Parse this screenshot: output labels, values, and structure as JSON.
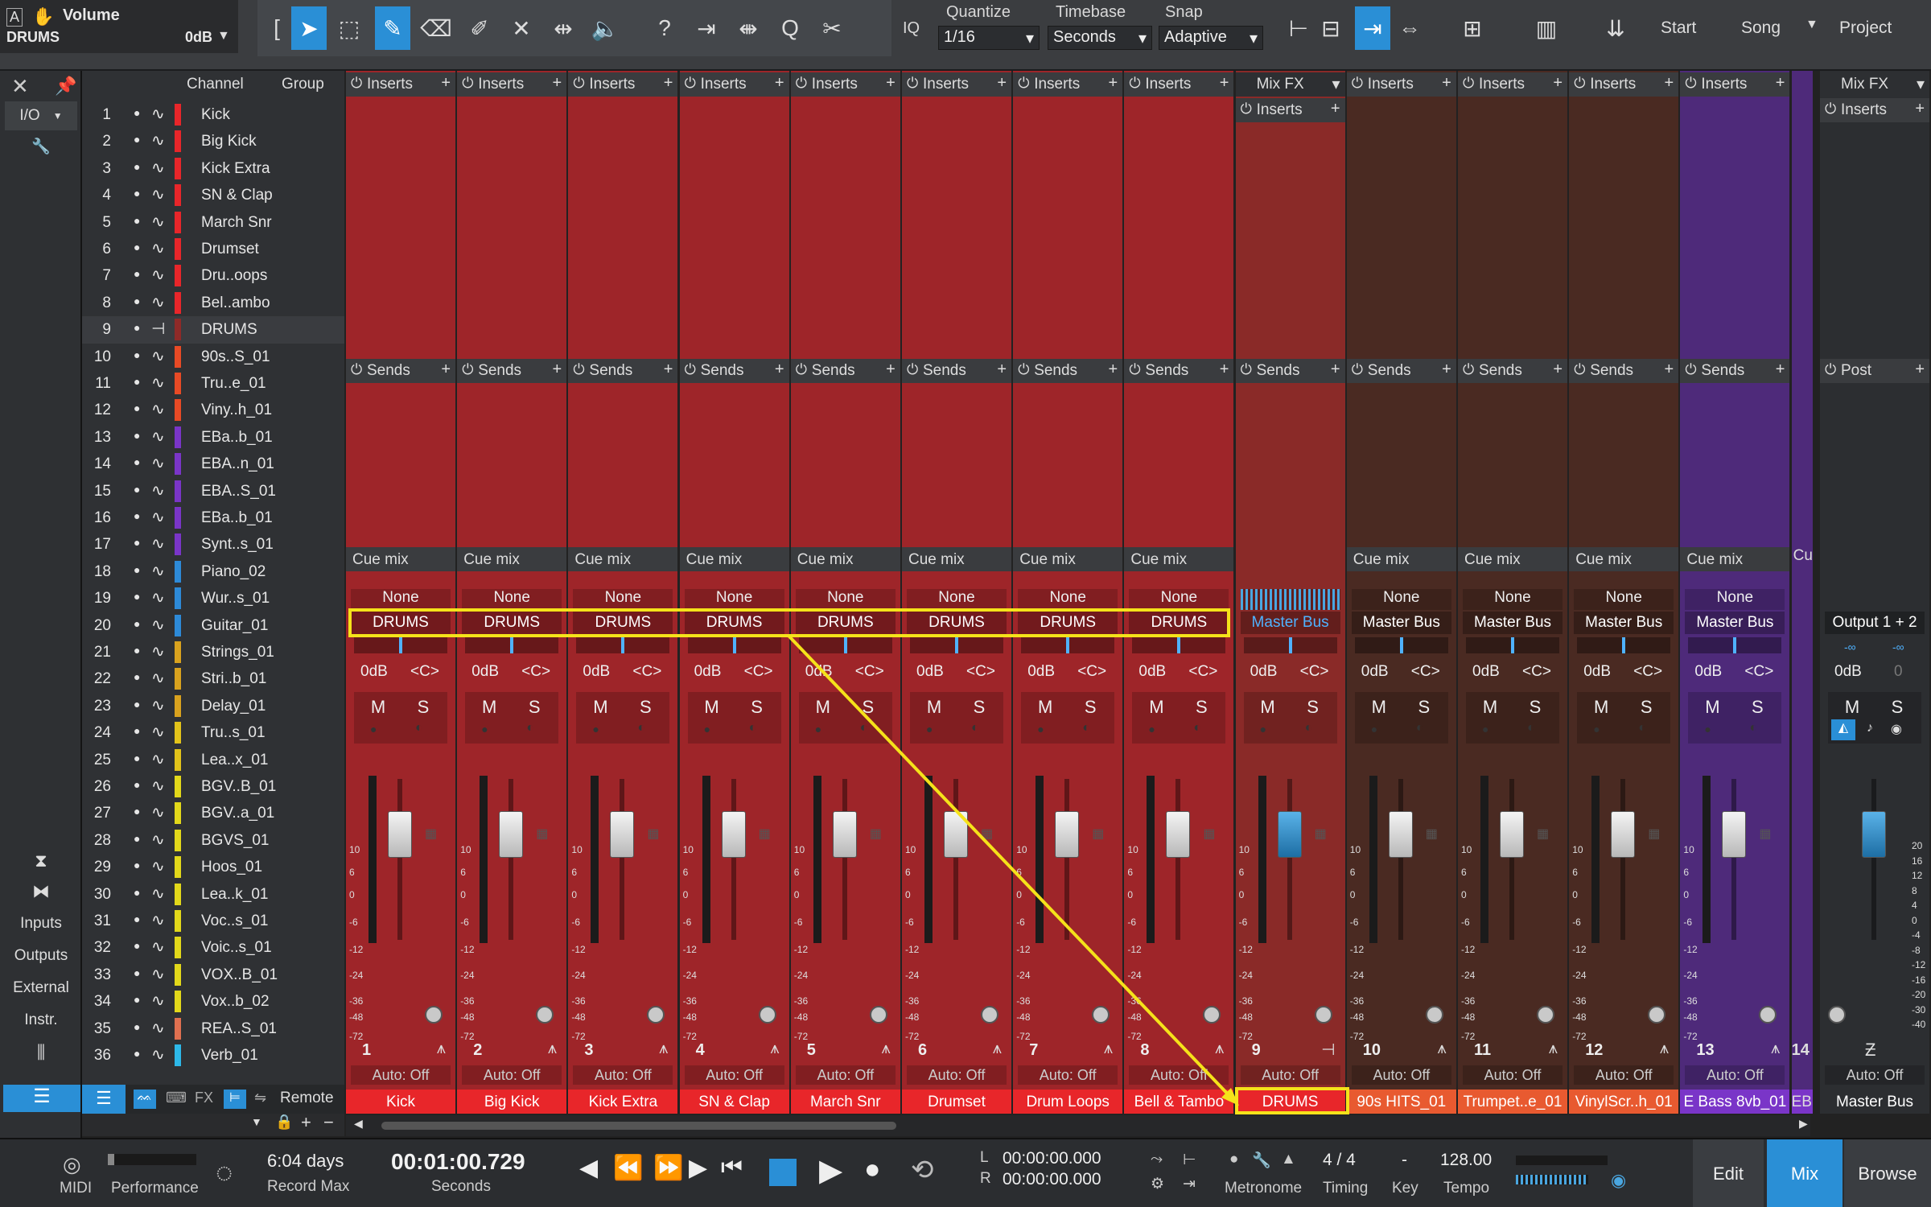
{
  "header": {
    "track_title": "Volume",
    "track_name": "DRUMS",
    "volume": "0dB"
  },
  "toolbar": {
    "iq": "IQ",
    "quantize_label": "Quantize",
    "quantize_value": "1/16",
    "timebase_label": "Timebase",
    "timebase_value": "Seconds",
    "snap_label": "Snap",
    "snap_value": "Adaptive",
    "start": "Start",
    "song": "Song",
    "project": "Project"
  },
  "sidebar": {
    "io": "I/O",
    "inputs": "Inputs",
    "outputs": "Outputs",
    "external": "External",
    "instr": "Instr."
  },
  "channel_list": {
    "col_channel": "Channel",
    "col_group": "Group",
    "rows": [
      {
        "n": "1",
        "name": "Kick",
        "color": "#e8262a"
      },
      {
        "n": "2",
        "name": "Big Kick",
        "color": "#e8262a"
      },
      {
        "n": "3",
        "name": "Kick Extra",
        "color": "#e8262a"
      },
      {
        "n": "4",
        "name": "SN & Clap",
        "color": "#e8262a"
      },
      {
        "n": "5",
        "name": "March Snr",
        "color": "#e8262a"
      },
      {
        "n": "6",
        "name": "Drumset",
        "color": "#e8262a"
      },
      {
        "n": "7",
        "name": "Dru..oops",
        "color": "#e8262a"
      },
      {
        "n": "8",
        "name": "Bel..ambo",
        "color": "#e8262a"
      },
      {
        "n": "9",
        "name": "DRUMS",
        "color": "#8f2a28"
      },
      {
        "n": "10",
        "name": "90s..S_01",
        "color": "#e84a25"
      },
      {
        "n": "11",
        "name": "Tru..e_01",
        "color": "#e84a25"
      },
      {
        "n": "12",
        "name": "Viny..h_01",
        "color": "#e84a25"
      },
      {
        "n": "13",
        "name": "EBa..b_01",
        "color": "#7a35c8"
      },
      {
        "n": "14",
        "name": "EBA..n_01",
        "color": "#7a35c8"
      },
      {
        "n": "15",
        "name": "EBA..S_01",
        "color": "#7a35c8"
      },
      {
        "n": "16",
        "name": "EBa..b_01",
        "color": "#7a35c8"
      },
      {
        "n": "17",
        "name": "Synt..s_01",
        "color": "#7a35c8"
      },
      {
        "n": "18",
        "name": "Piano_02",
        "color": "#2d8ad8"
      },
      {
        "n": "19",
        "name": "Wur..s_01",
        "color": "#2d8ad8"
      },
      {
        "n": "20",
        "name": "Guitar_01",
        "color": "#2d8ad8"
      },
      {
        "n": "21",
        "name": "Strings_01",
        "color": "#d9a21e"
      },
      {
        "n": "22",
        "name": "Stri..b_01",
        "color": "#d9a21e"
      },
      {
        "n": "23",
        "name": "Delay_01",
        "color": "#d9a21e"
      },
      {
        "n": "24",
        "name": "Tru..s_01",
        "color": "#e2c31a"
      },
      {
        "n": "25",
        "name": "Lea..x_01",
        "color": "#e2c31a"
      },
      {
        "n": "26",
        "name": "BGV..B_01",
        "color": "#e2d81a"
      },
      {
        "n": "27",
        "name": "BGV..a_01",
        "color": "#e2d81a"
      },
      {
        "n": "28",
        "name": "BGVS_01",
        "color": "#e2d81a"
      },
      {
        "n": "29",
        "name": "Hoos_01",
        "color": "#e2d81a"
      },
      {
        "n": "30",
        "name": "Lea..k_01",
        "color": "#e2d81a"
      },
      {
        "n": "31",
        "name": "Voc..s_01",
        "color": "#e2d81a"
      },
      {
        "n": "32",
        "name": "Voic..s_01",
        "color": "#e2d81a"
      },
      {
        "n": "33",
        "name": "VOX..B_01",
        "color": "#e2d81a"
      },
      {
        "n": "34",
        "name": "Vox..b_02",
        "color": "#e2d81a"
      },
      {
        "n": "35",
        "name": "REA..S_01",
        "color": "#e07050"
      },
      {
        "n": "36",
        "name": "Verb_01",
        "color": "#2db8e8"
      }
    ],
    "remote": "Remote"
  },
  "mixer": {
    "inserts_label": "Inserts",
    "sends_label": "Sends",
    "cue_label": "Cue mix",
    "mixfx_label": "Mix FX",
    "post_label": "Post",
    "none_label": "None",
    "auto_label": "Auto: Off",
    "m_label": "M",
    "s_label": "S",
    "vol_label": "0dB",
    "pan_label": "<C>",
    "strips": [
      {
        "num": "1",
        "name": "Kick",
        "output": "DRUMS",
        "bg": "#9e2529",
        "namebg": "#e8262a"
      },
      {
        "num": "2",
        "name": "Big Kick",
        "output": "DRUMS",
        "bg": "#9e2529",
        "namebg": "#e8262a"
      },
      {
        "num": "3",
        "name": "Kick Extra",
        "output": "DRUMS",
        "bg": "#9e2529",
        "namebg": "#e8262a"
      },
      {
        "num": "4",
        "name": "SN & Clap",
        "output": "DRUMS",
        "bg": "#9e2529",
        "namebg": "#e8262a"
      },
      {
        "num": "5",
        "name": "March Snr",
        "output": "DRUMS",
        "bg": "#9e2529",
        "namebg": "#e8262a"
      },
      {
        "num": "6",
        "name": "Drumset",
        "output": "DRUMS",
        "bg": "#9e2529",
        "namebg": "#e8262a"
      },
      {
        "num": "7",
        "name": "Drum Loops",
        "output": "DRUMS",
        "bg": "#9e2529",
        "namebg": "#e8262a"
      },
      {
        "num": "8",
        "name": "Bell & Tambo",
        "output": "DRUMS",
        "bg": "#9e2529",
        "namebg": "#e8262a"
      },
      {
        "num": "9",
        "name": "DRUMS",
        "output": "Master Bus",
        "bg": "#8a2a28",
        "namebg": "#e8262a"
      },
      {
        "num": "10",
        "name": "90s HITS_01",
        "output": "Master Bus",
        "bg": "#4a2a22",
        "namebg": "#e85a30"
      },
      {
        "num": "11",
        "name": "Trumpet..e_01",
        "output": "Master Bus",
        "bg": "#4a2a22",
        "namebg": "#e85a30"
      },
      {
        "num": "12",
        "name": "VinylScr..h_01",
        "output": "Master Bus",
        "bg": "#4a2a22",
        "namebg": "#e85a30"
      },
      {
        "num": "13",
        "name": "E Bass 8vb_01",
        "output": "Master Bus",
        "bg": "#4e2a7a",
        "namebg": "#7a35c8"
      }
    ],
    "partial": {
      "name": "EB",
      "num": "14",
      "cue": "Cu"
    },
    "master": {
      "name": "Master Bus",
      "output": "Output 1 + 2",
      "vol": "0dB",
      "pan": "0",
      "neg_inf": "-∞"
    },
    "scale_left": [
      "10",
      "6",
      "0",
      "-6",
      "-12",
      "-24",
      "-36",
      "-48",
      "-72"
    ],
    "scale_right": [
      "20",
      "16",
      "12",
      "8",
      "4",
      "0",
      "-4",
      "-8",
      "-12",
      "-16",
      "-20",
      "-30",
      "-40"
    ]
  },
  "transport": {
    "midi": "MIDI",
    "performance": "Performance",
    "record_days": "6:04 days",
    "record_max": "Record Max",
    "time": "00:01:00.729",
    "time_unit": "Seconds",
    "l": "L",
    "r": "R",
    "loop_l": "00:00:00.000",
    "loop_r": "00:00:00.000",
    "metronome": "Metronome",
    "timing_value": "4 / 4",
    "timing_label": "Timing",
    "key_value": "-",
    "key_label": "Key",
    "tempo_value": "128.00",
    "tempo_label": "Tempo",
    "edit": "Edit",
    "mix": "Mix",
    "browse": "Browse"
  }
}
